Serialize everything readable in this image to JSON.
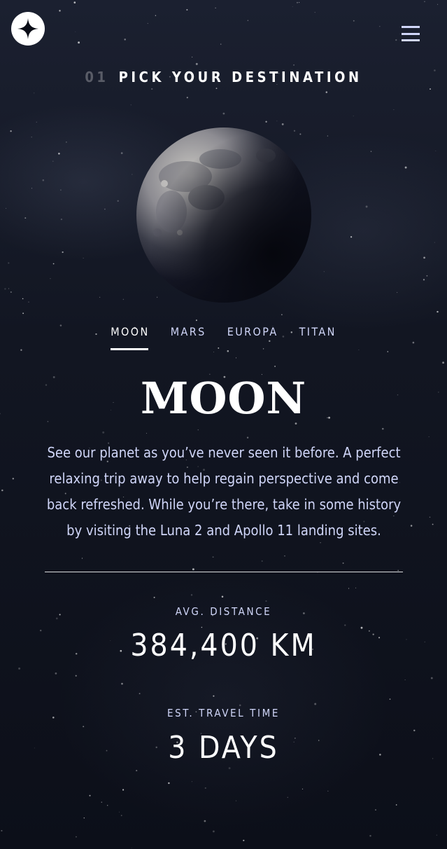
{
  "header": {
    "logo_icon": "star-logo-icon",
    "menu_icon": "hamburger-menu-icon"
  },
  "eyebrow": {
    "number": "01",
    "title": "PICK YOUR DESTINATION"
  },
  "tabs": [
    {
      "label": "MOON",
      "active": true
    },
    {
      "label": "MARS",
      "active": false
    },
    {
      "label": "EUROPA",
      "active": false
    },
    {
      "label": "TITAN",
      "active": false
    }
  ],
  "destination": {
    "name": "MOON",
    "description": "See our planet as you’ve never seen it before. A perfect relaxing trip away to help regain perspective and come back refreshed. While you’re there, take in some history by visiting the Luna 2 and Apollo 11 landing sites."
  },
  "stats": {
    "distance_label": "AVG. DISTANCE",
    "distance_value": "384,400 KM",
    "travel_label": "EST. TRAVEL TIME",
    "travel_value": "3 DAYS"
  },
  "colors": {
    "background": "#0b0d17",
    "accent": "#d0d6f9",
    "white": "#ffffff"
  }
}
